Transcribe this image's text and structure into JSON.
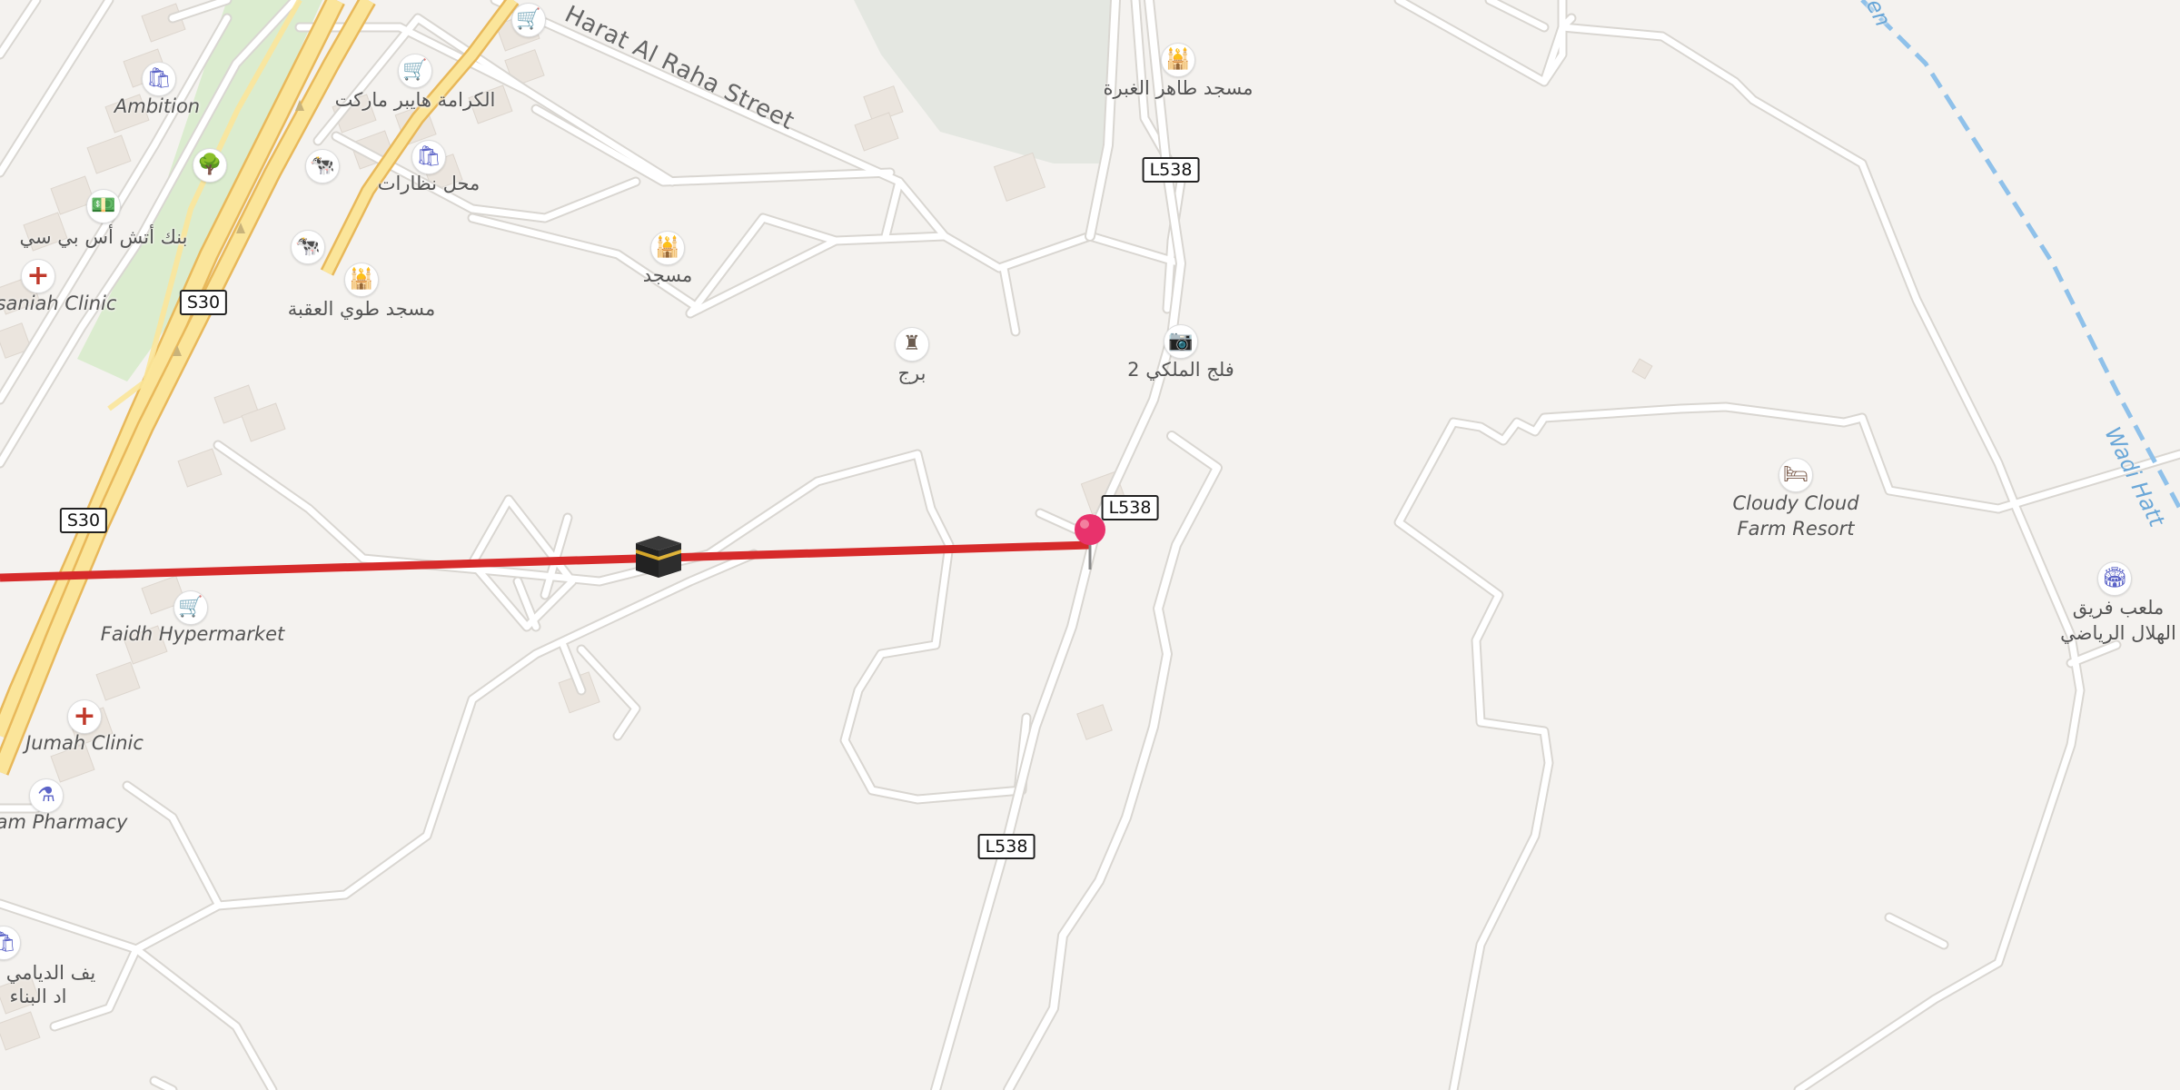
{
  "map": {
    "colors": {
      "background": "#f4f2ef",
      "route": "#d62a2a",
      "road": "#ffffff",
      "road_casing": "#d9d6d1",
      "highway": "#fbe59a",
      "highway_casing": "#e8b85a",
      "park": "#dbeccf",
      "cemetery": "#e4e7e1",
      "building": "#ebe5de",
      "waterway": "#8fc1ea",
      "pin": "#e8326c"
    },
    "streets": {
      "harat_al_raha": "Harat Al Raha Street",
      "wadi": "Wadi Hatt",
      "wadi_top": "en"
    },
    "shields": {
      "s30_a": "S30",
      "s30_b": "S30",
      "l538_a": "L538",
      "l538_b": "L538",
      "l538_c": "L538"
    },
    "places": {
      "ambition": "Ambition",
      "karama_market": "الكرامة هايبر ماركت",
      "optics_shop": "محل نظارات",
      "bank": "بنك أتش أس بي سي",
      "clinic_top": "saniah Clinic",
      "mosque_aqaba": "مسجد طوي العقبة",
      "mosque": "مسجد",
      "mosque_top": "مسجد طاهر الغبرة",
      "tower": "برج",
      "falaj": "فلج الملكي 2",
      "faidh": "Faidh Hypermarket",
      "jumah_clinic": "Jumah Clinic",
      "pharmacy": "am Pharmacy",
      "bottom_left_line1": "يف الديامي",
      "bottom_left_line2": "اد البناء",
      "cloudy_cloud": "Cloudy Cloud\nFarm Resort",
      "playground": "ملعب فريق\nالهلال الرياضي"
    },
    "icons": {
      "shop_basket": "shopping-basket-icon",
      "shop_cart": "shopping-cart-icon",
      "clinic": "medical-cross-icon",
      "livestock": "cow-icon",
      "mosque": "mosque-icon",
      "tree": "tree-icon",
      "bank": "banknote-icon",
      "pharmacy": "pharmacy-icon",
      "hotel": "bed-icon",
      "sport": "stadium-icon",
      "tower": "tower-icon",
      "camera": "camera-icon",
      "kaaba": "kaaba-icon",
      "pin": "location-pin-icon"
    }
  }
}
